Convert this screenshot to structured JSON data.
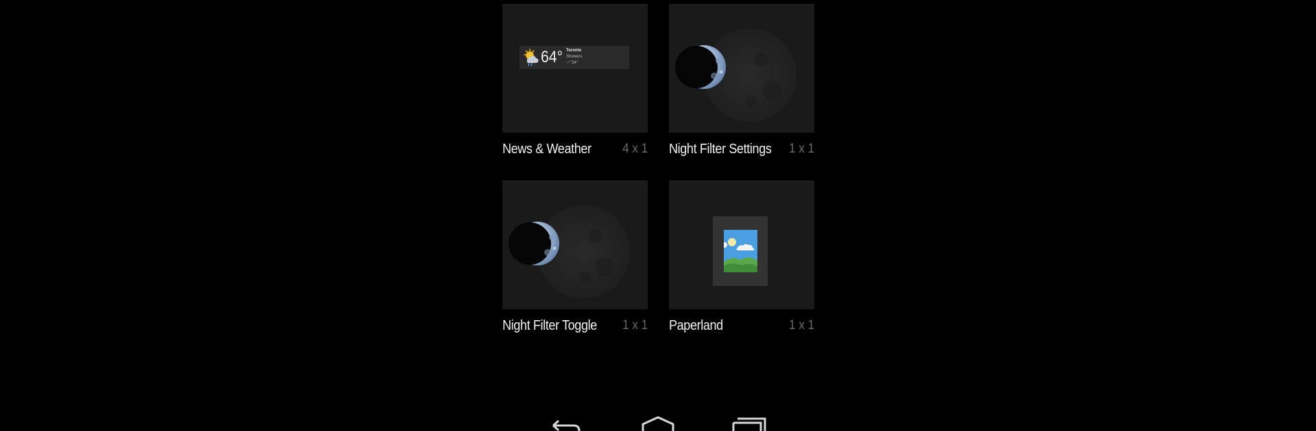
{
  "widgets": [
    {
      "name": "News & Weather",
      "size": "4 x 1",
      "preview": "weather"
    },
    {
      "name": "Night Filter Settings",
      "size": "1 x 1",
      "preview": "moon"
    },
    {
      "name": "Night Filter Toggle",
      "size": "1 x 1",
      "preview": "moon"
    },
    {
      "name": "Paperland",
      "size": "1 x 1",
      "preview": "picture"
    }
  ],
  "weather_preview": {
    "temperature": "64°",
    "city": "Toronto",
    "condition": "Showers",
    "range": "--° 54°",
    "icon": "partly-cloudy-rain-icon"
  },
  "nav_bar": {
    "buttons": [
      {
        "name": "back-button",
        "icon": "back-arrow-icon"
      },
      {
        "name": "home-button",
        "icon": "home-icon"
      },
      {
        "name": "recent-apps-button",
        "icon": "recent-apps-icon"
      }
    ]
  },
  "colors": {
    "background": "#000000",
    "preview_background": "#1a1a1a",
    "label_text": "#f2f2f2",
    "size_text": "#6a6a6a"
  }
}
